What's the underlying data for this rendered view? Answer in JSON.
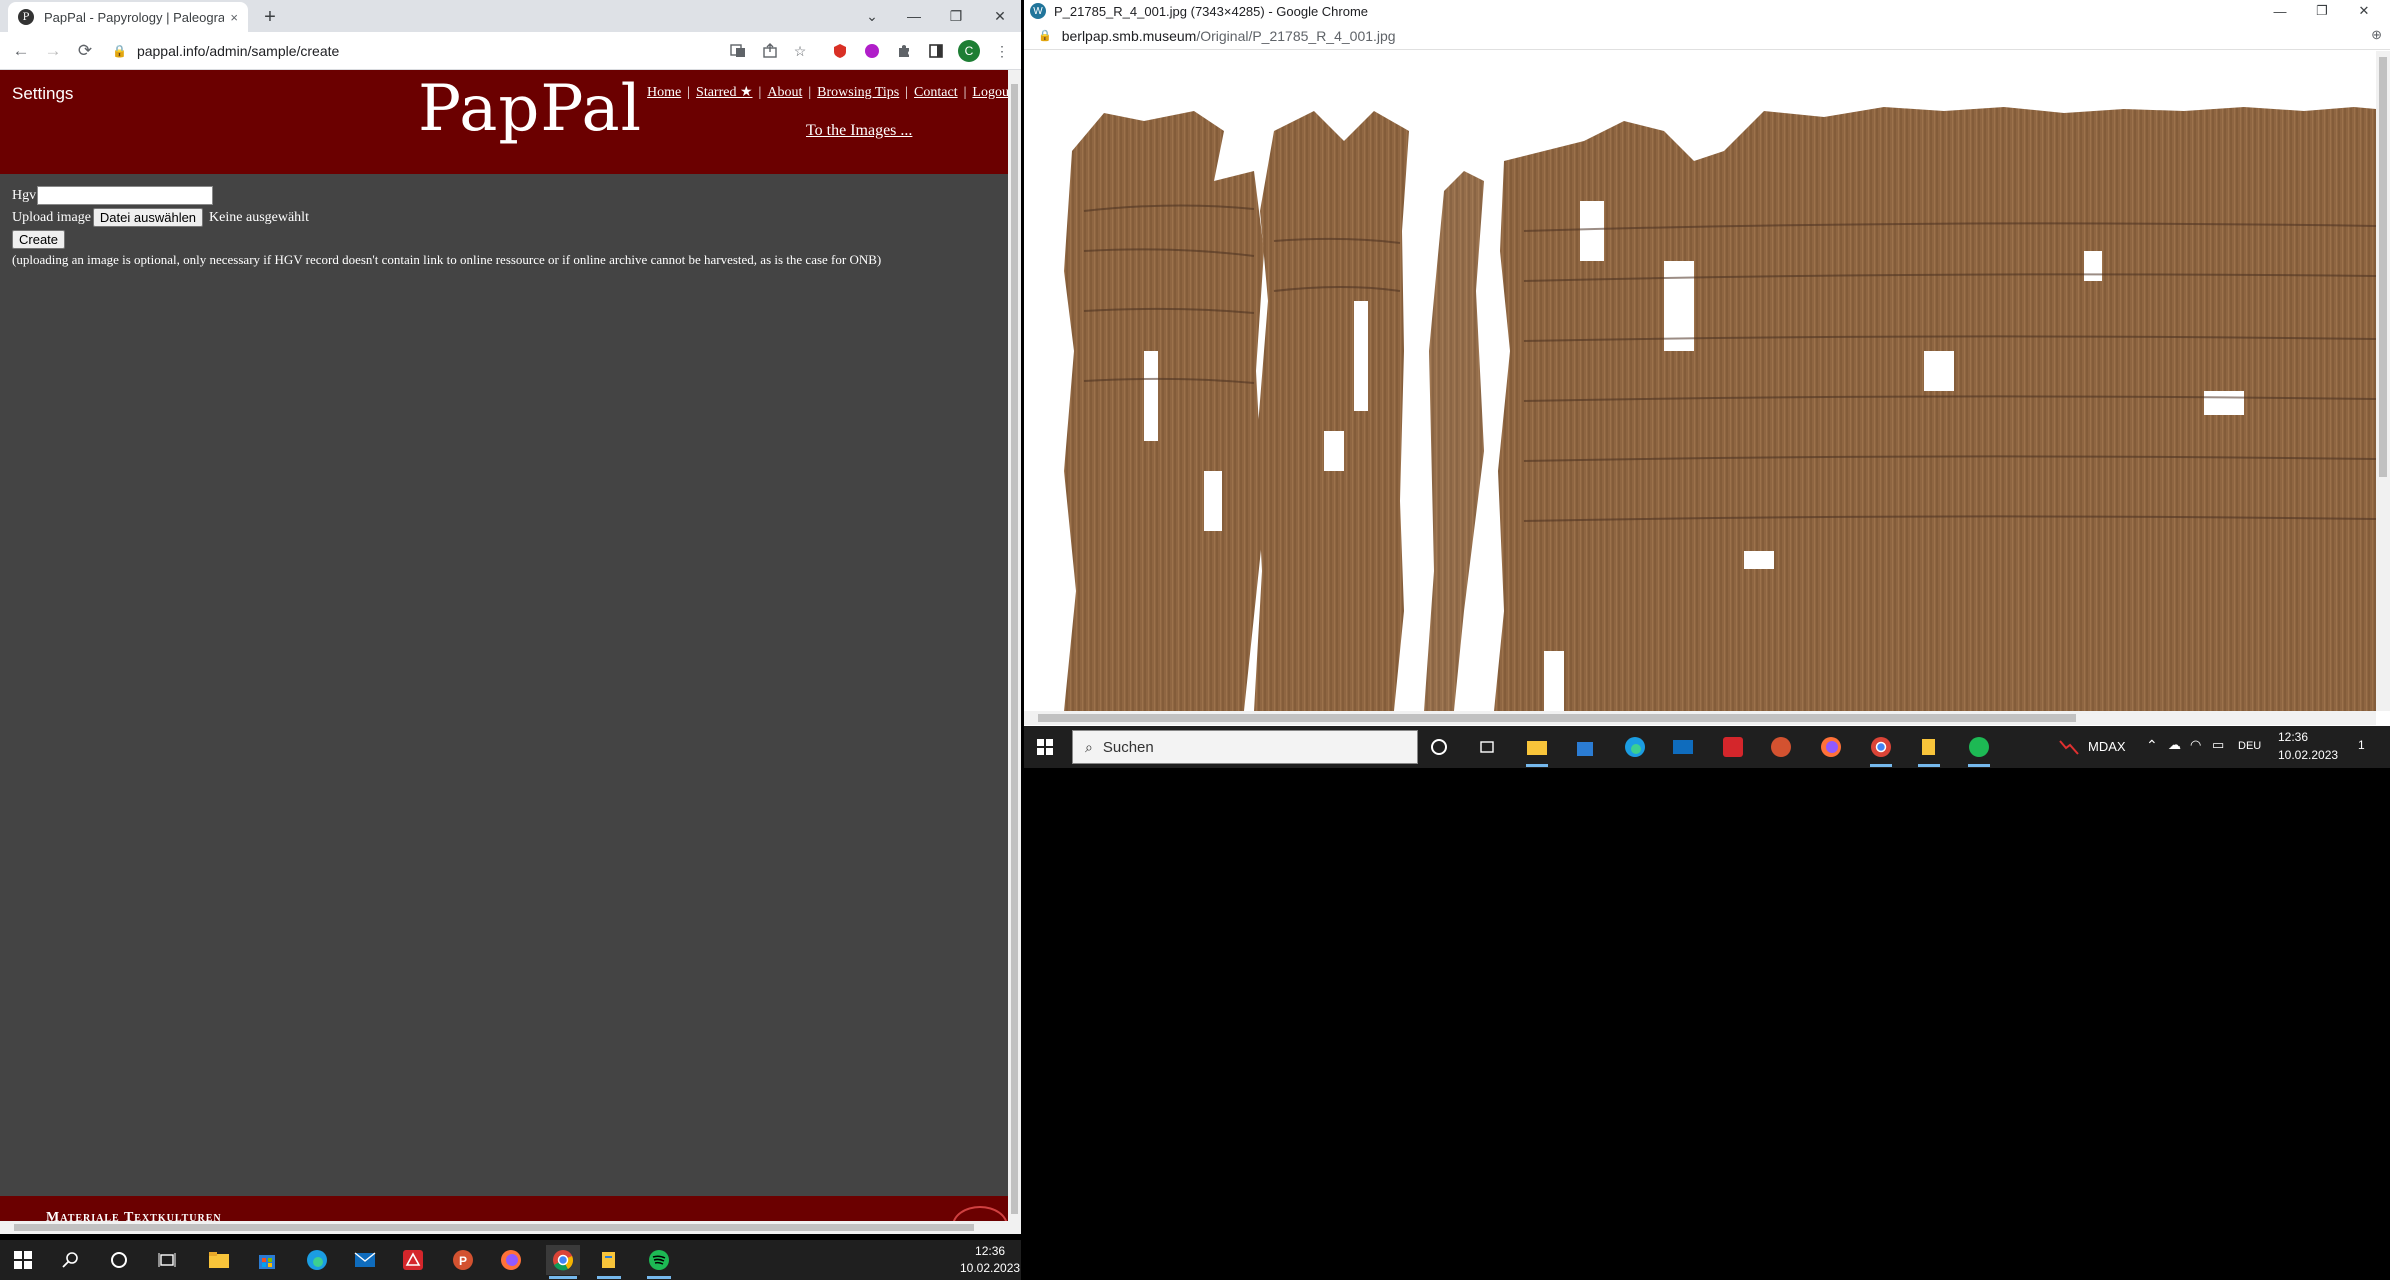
{
  "left_window": {
    "tab": {
      "favicon": "P",
      "title": "PapPal - Papyrology | Paleograph",
      "close": "×"
    },
    "new_tab": "+",
    "window_controls": {
      "minimize": "—",
      "restore": "❐",
      "close": "✕",
      "dropdown": "⌄"
    },
    "toolbar": {
      "back": "←",
      "forward": "→",
      "reload": "⟳",
      "url": "pappal.info/admin/sample/create",
      "lock": "🔒",
      "profile": "C"
    }
  },
  "pappal": {
    "settings": "Settings",
    "logo": "PapPal",
    "nav": [
      {
        "label": "Home"
      },
      {
        "label": "Starred ★"
      },
      {
        "label": "About"
      },
      {
        "label": "Browsing Tips"
      },
      {
        "label": "Contact"
      },
      {
        "label": "Logout"
      }
    ],
    "nav_sep": "|",
    "to_images": "To the Images ...",
    "form": {
      "hgv_label": "Hgv",
      "hgv_value": "",
      "upload_label": "Upload image",
      "file_button": "Datei auswählen",
      "file_status": "Keine ausgewählt",
      "create_button": "Create",
      "note": "(uploading an image is optional, only necessary if HGV record doesn't contain link to online ressource or if online archive cannot be harvested, as is the case for ONB)"
    },
    "footer": "Materiale Textkulturen"
  },
  "right_window": {
    "title": "P_21785_R_4_001.jpg (7343×4285) - Google Chrome",
    "favicon": "W",
    "window_controls": {
      "minimize": "—",
      "restore": "❐",
      "close": "✕"
    },
    "url_host": "berlpap.smb.museum",
    "url_path": "/Original/P_21785_R_4_001.jpg",
    "zoom_icon": "⊕",
    "taskbar": {
      "search_placeholder": "Suchen",
      "tray_mdax": "MDAX",
      "tray_lang": "DEU",
      "time": "12:36",
      "date": "10.02.2023",
      "notification_count": "1"
    }
  },
  "taskbar": {
    "time": "12:36",
    "date": "10.02.2023"
  },
  "colors": {
    "header": "#6b0000",
    "page_bg": "#444444",
    "papyrus": "#8b6240"
  }
}
